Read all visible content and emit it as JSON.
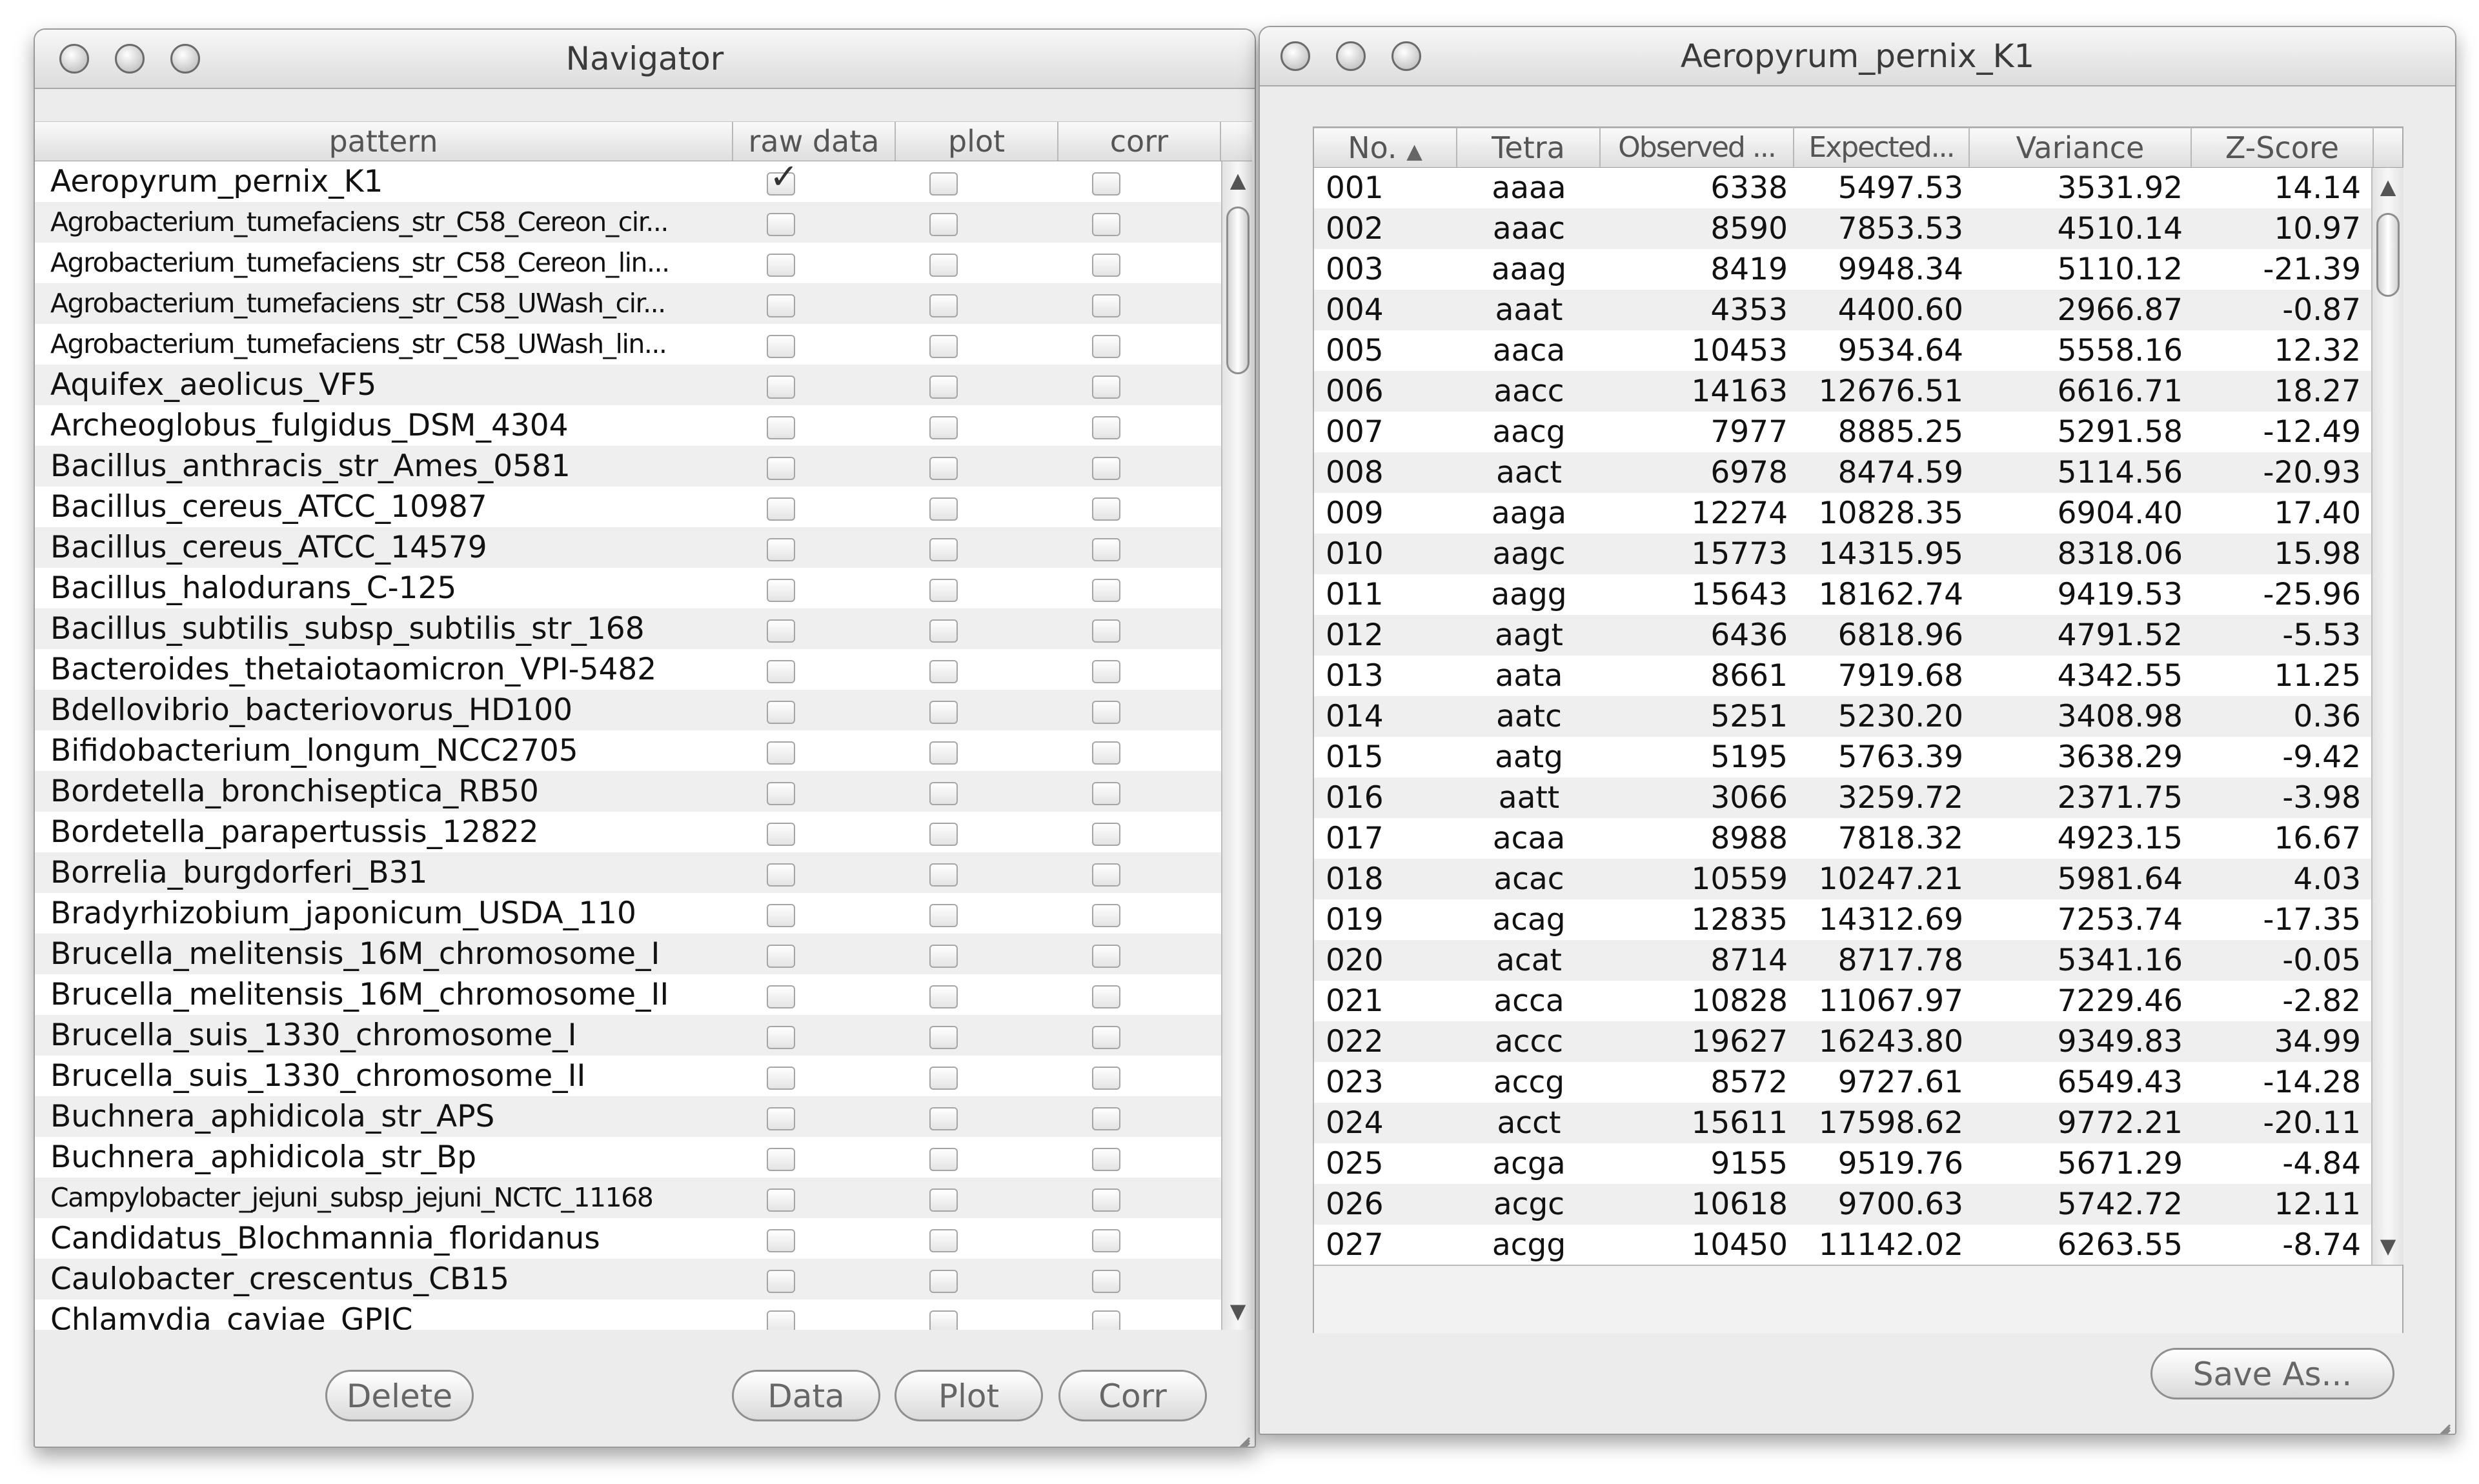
{
  "navigator": {
    "title": "Navigator",
    "columns": [
      "pattern",
      "raw data",
      "plot",
      "corr"
    ],
    "rows": [
      {
        "name": "Aeropyrum_pernix_K1",
        "raw": true
      },
      {
        "name": "Agrobacterium_tumefaciens_str_C58_Cereon_cir...",
        "raw": false
      },
      {
        "name": "Agrobacterium_tumefaciens_str_C58_Cereon_lin...",
        "raw": false
      },
      {
        "name": "Agrobacterium_tumefaciens_str_C58_UWash_cir...",
        "raw": false
      },
      {
        "name": "Agrobacterium_tumefaciens_str_C58_UWash_lin...",
        "raw": false
      },
      {
        "name": "Aquifex_aeolicus_VF5",
        "raw": false
      },
      {
        "name": "Archeoglobus_fulgidus_DSM_4304",
        "raw": false
      },
      {
        "name": "Bacillus_anthracis_str_Ames_0581",
        "raw": false
      },
      {
        "name": "Bacillus_cereus_ATCC_10987",
        "raw": false
      },
      {
        "name": "Bacillus_cereus_ATCC_14579",
        "raw": false
      },
      {
        "name": "Bacillus_halodurans_C-125",
        "raw": false
      },
      {
        "name": "Bacillus_subtilis_subsp_subtilis_str_168",
        "raw": false
      },
      {
        "name": "Bacteroides_thetaiotaomicron_VPI-5482",
        "raw": false
      },
      {
        "name": "Bdellovibrio_bacteriovorus_HD100",
        "raw": false
      },
      {
        "name": "Bifidobacterium_longum_NCC2705",
        "raw": false
      },
      {
        "name": "Bordetella_bronchiseptica_RB50",
        "raw": false
      },
      {
        "name": "Bordetella_parapertussis_12822",
        "raw": false
      },
      {
        "name": "Borrelia_burgdorferi_B31",
        "raw": false
      },
      {
        "name": "Bradyrhizobium_japonicum_USDA_110",
        "raw": false
      },
      {
        "name": "Brucella_melitensis_16M_chromosome_I",
        "raw": false
      },
      {
        "name": "Brucella_melitensis_16M_chromosome_II",
        "raw": false
      },
      {
        "name": "Brucella_suis_1330_chromosome_I",
        "raw": false
      },
      {
        "name": "Brucella_suis_1330_chromosome_II",
        "raw": false
      },
      {
        "name": "Buchnera_aphidicola_str_APS",
        "raw": false
      },
      {
        "name": "Buchnera_aphidicola_str_Bp",
        "raw": false
      },
      {
        "name": "Campylobacter_jejuni_subsp_jejuni_NCTC_11168",
        "raw": false
      },
      {
        "name": "Candidatus_Blochmannia_floridanus",
        "raw": false
      },
      {
        "name": "Caulobacter_crescentus_CB15",
        "raw": false
      },
      {
        "name": "Chlamydia_caviae_GPIC",
        "raw": false
      }
    ],
    "buttons": {
      "delete": "Delete",
      "data": "Data",
      "plot": "Plot",
      "corr": "Corr"
    }
  },
  "detail": {
    "title": "Aeropyrum_pernix_K1",
    "columns": [
      "No.",
      "Tetra",
      "Observed ...",
      "Expected...",
      "Variance",
      "Z-Score"
    ],
    "sort_indicator": "▲",
    "rows": [
      [
        "001",
        "aaaa",
        "6338",
        "5497.53",
        "3531.92",
        "14.14"
      ],
      [
        "002",
        "aaac",
        "8590",
        "7853.53",
        "4510.14",
        "10.97"
      ],
      [
        "003",
        "aaag",
        "8419",
        "9948.34",
        "5110.12",
        "-21.39"
      ],
      [
        "004",
        "aaat",
        "4353",
        "4400.60",
        "2966.87",
        "-0.87"
      ],
      [
        "005",
        "aaca",
        "10453",
        "9534.64",
        "5558.16",
        "12.32"
      ],
      [
        "006",
        "aacc",
        "14163",
        "12676.51",
        "6616.71",
        "18.27"
      ],
      [
        "007",
        "aacg",
        "7977",
        "8885.25",
        "5291.58",
        "-12.49"
      ],
      [
        "008",
        "aact",
        "6978",
        "8474.59",
        "5114.56",
        "-20.93"
      ],
      [
        "009",
        "aaga",
        "12274",
        "10828.35",
        "6904.40",
        "17.40"
      ],
      [
        "010",
        "aagc",
        "15773",
        "14315.95",
        "8318.06",
        "15.98"
      ],
      [
        "011",
        "aagg",
        "15643",
        "18162.74",
        "9419.53",
        "-25.96"
      ],
      [
        "012",
        "aagt",
        "6436",
        "6818.96",
        "4791.52",
        "-5.53"
      ],
      [
        "013",
        "aata",
        "8661",
        "7919.68",
        "4342.55",
        "11.25"
      ],
      [
        "014",
        "aatc",
        "5251",
        "5230.20",
        "3408.98",
        "0.36"
      ],
      [
        "015",
        "aatg",
        "5195",
        "5763.39",
        "3638.29",
        "-9.42"
      ],
      [
        "016",
        "aatt",
        "3066",
        "3259.72",
        "2371.75",
        "-3.98"
      ],
      [
        "017",
        "acaa",
        "8988",
        "7818.32",
        "4923.15",
        "16.67"
      ],
      [
        "018",
        "acac",
        "10559",
        "10247.21",
        "5981.64",
        "4.03"
      ],
      [
        "019",
        "acag",
        "12835",
        "14312.69",
        "7253.74",
        "-17.35"
      ],
      [
        "020",
        "acat",
        "8714",
        "8717.78",
        "5341.16",
        "-0.05"
      ],
      [
        "021",
        "acca",
        "10828",
        "11067.97",
        "7229.46",
        "-2.82"
      ],
      [
        "022",
        "accc",
        "19627",
        "16243.80",
        "9349.83",
        "34.99"
      ],
      [
        "023",
        "accg",
        "8572",
        "9727.61",
        "6549.43",
        "-14.28"
      ],
      [
        "024",
        "acct",
        "15611",
        "17598.62",
        "9772.21",
        "-20.11"
      ],
      [
        "025",
        "acga",
        "9155",
        "9519.76",
        "5671.29",
        "-4.84"
      ],
      [
        "026",
        "acgc",
        "10618",
        "9700.63",
        "5742.72",
        "12.11"
      ],
      [
        "027",
        "acgg",
        "10450",
        "11142.02",
        "6263.55",
        "-8.74"
      ]
    ],
    "buttons": {
      "save_as": "Save As..."
    }
  }
}
